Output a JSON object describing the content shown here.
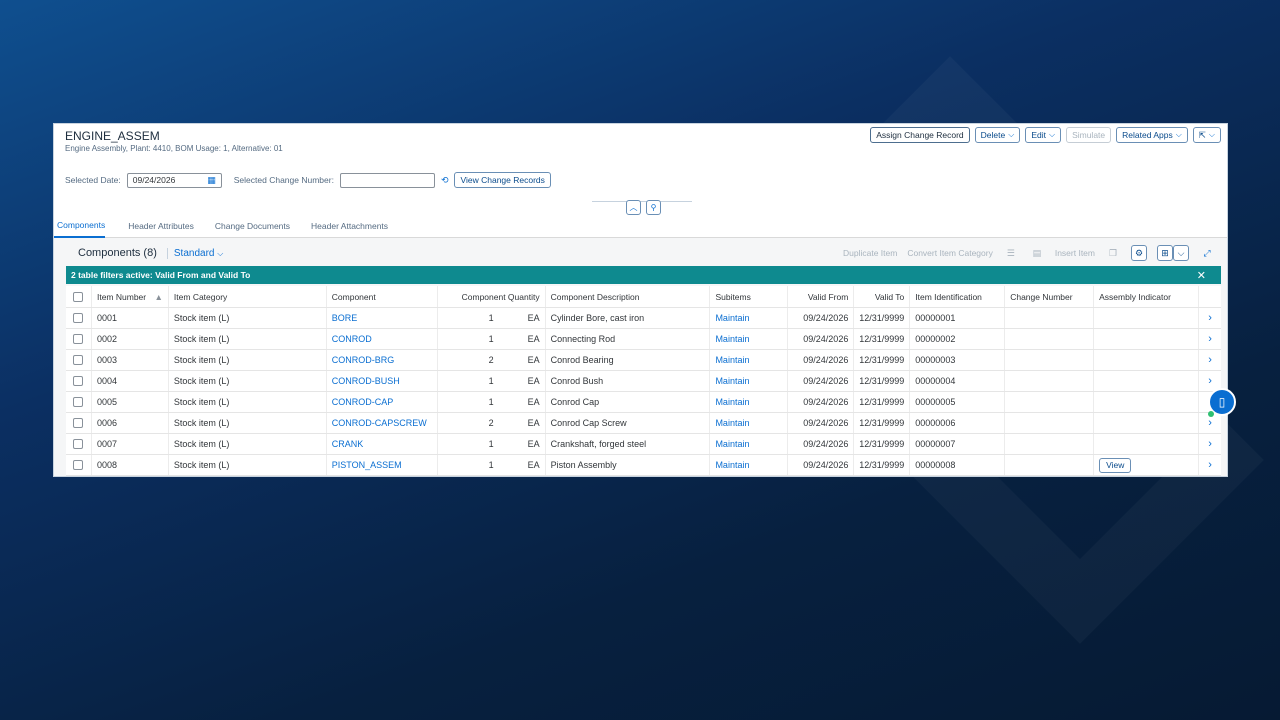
{
  "header": {
    "title": "ENGINE_ASSEM",
    "subtitle": "Engine Assembly, Plant: 4410, BOM Usage: 1, Alternative: 01",
    "actions": {
      "assign": "Assign Change Record",
      "delete": "Delete",
      "edit": "Edit",
      "simulate": "Simulate",
      "related": "Related Apps"
    }
  },
  "filters": {
    "selected_date_label": "Selected Date:",
    "selected_date_value": "09/24/2026",
    "change_number_label": "Selected Change Number:",
    "change_number_value": "",
    "view_change_records": "View Change Records"
  },
  "tabs": [
    "Components",
    "Header Attributes",
    "Change Documents",
    "Header Attachments"
  ],
  "components": {
    "title": "Components (8)",
    "variant": "Standard",
    "toolbar": {
      "duplicate": "Duplicate Item",
      "convert": "Convert Item Category",
      "insert": "Insert Item"
    },
    "info_bar": "2 table filters active: Valid From and Valid To",
    "columns": [
      "Item Number",
      "Item Category",
      "Component",
      "Component Quantity",
      "Component Description",
      "Subitems",
      "Valid From",
      "Valid To",
      "Item Identification",
      "Change Number",
      "Assembly Indicator"
    ],
    "rows": [
      {
        "item": "0001",
        "category": "Stock item (L)",
        "component": "BORE",
        "qty": "1",
        "unit": "EA",
        "desc": "Cylinder Bore, cast iron",
        "subitems": "Maintain",
        "from": "09/24/2026",
        "to": "12/31/9999",
        "ident": "00000001",
        "change": "",
        "assembly": ""
      },
      {
        "item": "0002",
        "category": "Stock item (L)",
        "component": "CONROD",
        "qty": "1",
        "unit": "EA",
        "desc": "Connecting Rod",
        "subitems": "Maintain",
        "from": "09/24/2026",
        "to": "12/31/9999",
        "ident": "00000002",
        "change": "",
        "assembly": ""
      },
      {
        "item": "0003",
        "category": "Stock item (L)",
        "component": "CONROD-BRG",
        "qty": "2",
        "unit": "EA",
        "desc": "Conrod Bearing",
        "subitems": "Maintain",
        "from": "09/24/2026",
        "to": "12/31/9999",
        "ident": "00000003",
        "change": "",
        "assembly": ""
      },
      {
        "item": "0004",
        "category": "Stock item (L)",
        "component": "CONROD-BUSH",
        "qty": "1",
        "unit": "EA",
        "desc": "Conrod Bush",
        "subitems": "Maintain",
        "from": "09/24/2026",
        "to": "12/31/9999",
        "ident": "00000004",
        "change": "",
        "assembly": ""
      },
      {
        "item": "0005",
        "category": "Stock item (L)",
        "component": "CONROD-CAP",
        "qty": "1",
        "unit": "EA",
        "desc": "Conrod Cap",
        "subitems": "Maintain",
        "from": "09/24/2026",
        "to": "12/31/9999",
        "ident": "00000005",
        "change": "",
        "assembly": ""
      },
      {
        "item": "0006",
        "category": "Stock item (L)",
        "component": "CONROD-CAPSCREW",
        "qty": "2",
        "unit": "EA",
        "desc": "Conrod Cap Screw",
        "subitems": "Maintain",
        "from": "09/24/2026",
        "to": "12/31/9999",
        "ident": "00000006",
        "change": "",
        "assembly": ""
      },
      {
        "item": "0007",
        "category": "Stock item (L)",
        "component": "CRANK",
        "qty": "1",
        "unit": "EA",
        "desc": "Crankshaft, forged steel",
        "subitems": "Maintain",
        "from": "09/24/2026",
        "to": "12/31/9999",
        "ident": "00000007",
        "change": "",
        "assembly": ""
      },
      {
        "item": "0008",
        "category": "Stock item (L)",
        "component": "PISTON_ASSEM",
        "qty": "1",
        "unit": "EA",
        "desc": "Piston Assembly",
        "subitems": "Maintain",
        "from": "09/24/2026",
        "to": "12/31/9999",
        "ident": "00000008",
        "change": "",
        "assembly": "View"
      }
    ]
  }
}
